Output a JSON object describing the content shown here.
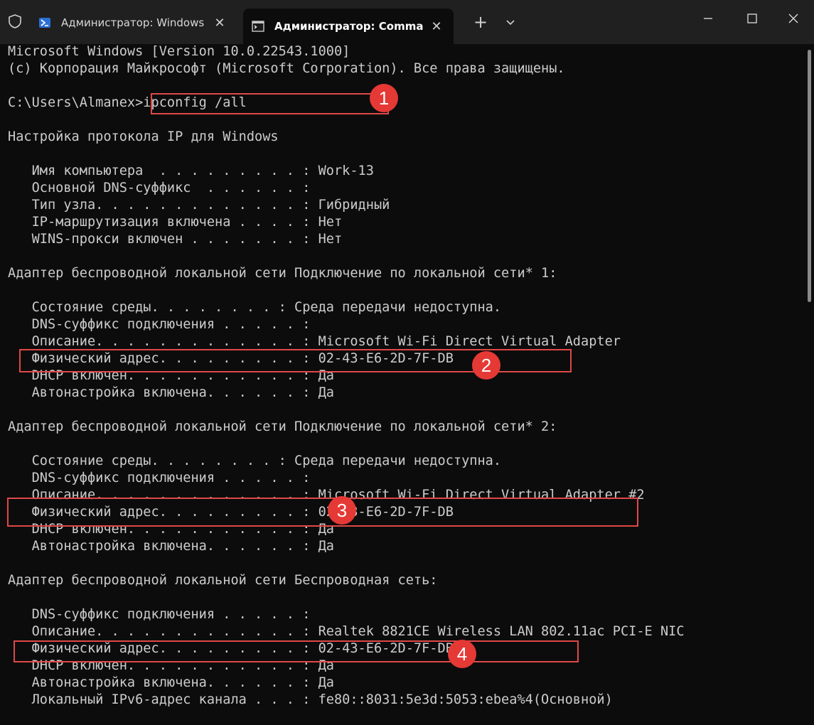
{
  "tabs": [
    {
      "label": "Администратор: Windows PowerShell"
    },
    {
      "label": "Администратор: Command Prompt"
    }
  ],
  "new_tab_symbol": "+",
  "colors": {
    "titlebar_bg": "#202020",
    "console_bg": "#0c0c0c",
    "console_text": "#cccccc",
    "annotation_red": "#e53935"
  },
  "console": {
    "lines": [
      "Microsoft Windows [Version 10.0.22543.1000]",
      "(c) Корпорация Майкрософт (Microsoft Corporation). Все права защищены.",
      "",
      "C:\\Users\\Almanex>ipconfig /all",
      "",
      "Настройка протокола IP для Windows",
      "",
      "   Имя компьютера  . . . . . . . . . : Work-13",
      "   Основной DNS-суффикс  . . . . . . :",
      "   Тип узла. . . . . . . . . . . . . : Гибридный",
      "   IP-маршрутизация включена . . . . : Нет",
      "   WINS-прокси включен . . . . . . . : Нет",
      "",
      "Адаптер беспроводной локальной сети Подключение по локальной сети* 1:",
      "",
      "   Состояние среды. . . . . . . . : Среда передачи недоступна.",
      "   DNS-суффикс подключения . . . . . :",
      "   Описание. . . . . . . . . . . . . : Microsoft Wi-Fi Direct Virtual Adapter",
      "   Физический адрес. . . . . . . . . : 02-43-E6-2D-7F-DB",
      "   DHCP включен. . . . . . . . . . . : Да",
      "   Автонастройка включена. . . . . . : Да",
      "",
      "Адаптер беспроводной локальной сети Подключение по локальной сети* 2:",
      "",
      "   Состояние среды. . . . . . . . : Среда передачи недоступна.",
      "   DNS-суффикс подключения . . . . . :",
      "   Описание. . . . . . . . . . . . . : Microsoft Wi-Fi Direct Virtual Adapter #2",
      "   Физический адрес. . . . . . . . . : 02-43-E6-2D-7F-DB",
      "   DHCP включен. . . . . . . . . . . : Да",
      "   Автонастройка включена. . . . . . : Да",
      "",
      "Адаптер беспроводной локальной сети Беспроводная сеть:",
      "",
      "   DNS-суффикс подключения . . . . . :",
      "   Описание. . . . . . . . . . . . . : Realtek 8821CE Wireless LAN 802.11ac PCI-E NIC",
      "   Физический адрес. . . . . . . . . : 02-43-E6-2D-7F-DB",
      "   DHCP включен. . . . . . . . . . . : Да",
      "   Автонастройка включена. . . . . . : Да",
      "   Локальный IPv6-адрес канала . . . : fe80::8031:5e3d:5053:ebea%4(Основной)"
    ]
  },
  "annotations": [
    {
      "number": "1"
    },
    {
      "number": "2"
    },
    {
      "number": "3"
    },
    {
      "number": "4"
    }
  ]
}
